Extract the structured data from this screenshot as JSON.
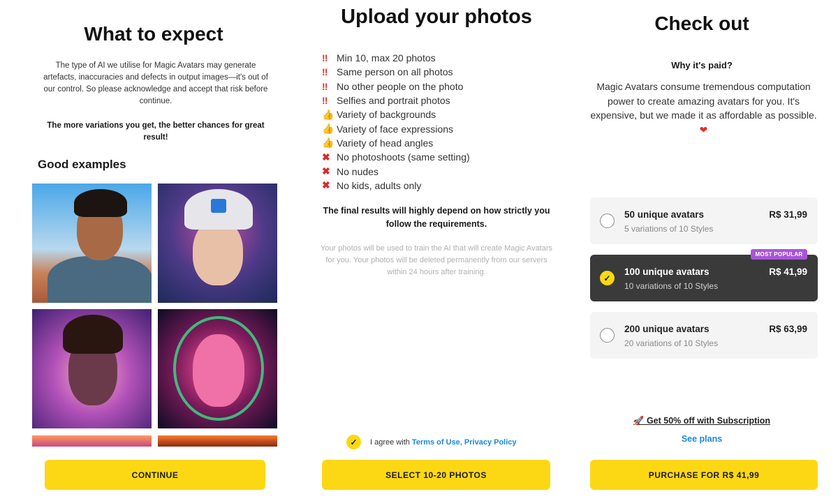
{
  "expect": {
    "title": "What to expect",
    "description": "The type of AI we utilise for Magic Avatars may generate artefacts, inaccuracies and defects in output images—it's out of our control. So please acknowledge and accept that risk before continue.",
    "emphasis": "The more variations you get, the better chances for great result!",
    "good_examples_title": "Good examples",
    "continue_label": "CONTINUE"
  },
  "upload": {
    "title": "Upload your photos",
    "requirements": [
      {
        "icon": "double-exclamation-icon",
        "symbol": "‼",
        "text": "Min 10, max 20 photos"
      },
      {
        "icon": "double-exclamation-icon",
        "symbol": "‼",
        "text": "Same person on all photos"
      },
      {
        "icon": "double-exclamation-icon",
        "symbol": "‼",
        "text": "No other people on the photo"
      },
      {
        "icon": "double-exclamation-icon",
        "symbol": "‼",
        "text": "Selfies and portrait photos"
      },
      {
        "icon": "thumbs-up-icon",
        "symbol": "👍",
        "text": "Variety of backgrounds"
      },
      {
        "icon": "thumbs-up-icon",
        "symbol": "👍",
        "text": "Variety of face expressions"
      },
      {
        "icon": "thumbs-up-icon",
        "symbol": "👍",
        "text": "Variety of head angles"
      },
      {
        "icon": "cross-icon",
        "symbol": "✖",
        "text": "No photoshoots (same setting)"
      },
      {
        "icon": "cross-icon",
        "symbol": "✖",
        "text": "No nudes"
      },
      {
        "icon": "cross-icon",
        "symbol": "✖",
        "text": "No kids, adults only"
      }
    ],
    "emphasis": "The final results will highly depend on how strictly you follow the requirements.",
    "note": "Your photos will be used to train the AI that will create Magic Avatars for you. Your photos will be deleted permanently from our servers within 24 hours after training.",
    "agree_prefix": "I agree with ",
    "terms_label": "Terms of Use",
    "agree_sep": ", ",
    "privacy_label": "Privacy Policy",
    "select_label": "SELECT 10-20 PHOTOS"
  },
  "checkout": {
    "title": "Check out",
    "question": "Why it's paid?",
    "description": "Magic Avatars consume tremendous computation power to create amazing avatars for you. It's expensive, but we made it as affordable as possible.",
    "options": [
      {
        "name": "50 unique avatars",
        "sub": "5 variations of 10 Styles",
        "price": "R$ 31,99",
        "selected": false
      },
      {
        "name": "100 unique avatars",
        "sub": "10 variations of 10 Styles",
        "price": "R$ 41,99",
        "selected": true
      },
      {
        "name": "200 unique avatars",
        "sub": "20 variations of 10 Styles",
        "price": "R$ 63,99",
        "selected": false
      }
    ],
    "badge": "MOST POPULAR",
    "promo": "🚀 Get 50% off with Subscription",
    "see_plans": "See plans",
    "purchase_label": "PURCHASE FOR R$ 41,99"
  },
  "colors": {
    "accent_yellow": "#fcd814",
    "badge_purple": "#a855d8",
    "link_blue": "#1e88d8",
    "selected_dark": "#3a3a3a",
    "warning_red": "#e53030"
  }
}
